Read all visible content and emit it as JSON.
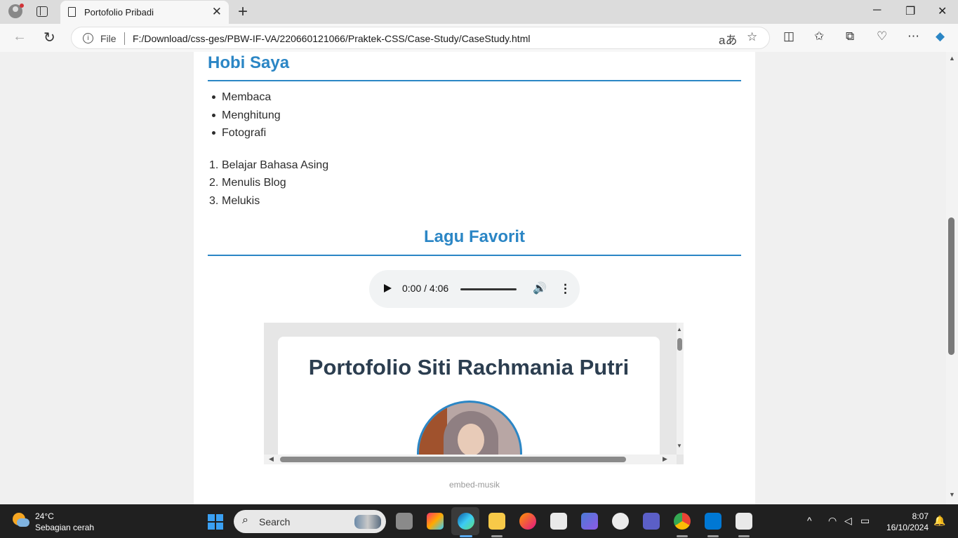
{
  "browser": {
    "tab_title": "Portofolio Pribadi",
    "file_label": "File",
    "url": "F:/Download/css-ges/PBW-IF-VA/220660121066/Praktek-CSS/Case-Study/CaseStudy.html"
  },
  "page": {
    "hobby_heading": "Hobi Saya",
    "unordered_hobbies": [
      "Membaca",
      "Menghitung",
      "Fotografi"
    ],
    "ordered_hobbies": [
      "Belajar Bahasa Asing",
      "Menulis Blog",
      "Melukis"
    ],
    "music_heading": "Lagu Favorit",
    "audio": {
      "current_time": "0:00",
      "separator": "/",
      "duration": "4:06"
    },
    "embed": {
      "title": "Portofolio Siti Rachmania Putri"
    },
    "embed_caption": "embed-musik"
  },
  "taskbar": {
    "temperature": "24°C",
    "weather": "Sebagian cerah",
    "search_placeholder": "Search",
    "time": "8:07",
    "date": "16/10/2024"
  },
  "colors": {
    "accent": "#2b86c5",
    "heading_dark": "#2c3e50"
  },
  "icons": [
    "profile-icon",
    "tabs-icon",
    "page-icon",
    "close-icon",
    "plus-icon",
    "back-icon",
    "refresh-icon",
    "info-icon",
    "read-aloud-icon",
    "star-icon",
    "split-screen-icon",
    "favorites-icon",
    "collections-icon",
    "browser-essentials-icon",
    "more-icon",
    "copilot-icon",
    "play-icon",
    "volume-icon",
    "search-icon",
    "wifi-icon",
    "speaker-icon",
    "battery-icon",
    "bell-icon"
  ]
}
